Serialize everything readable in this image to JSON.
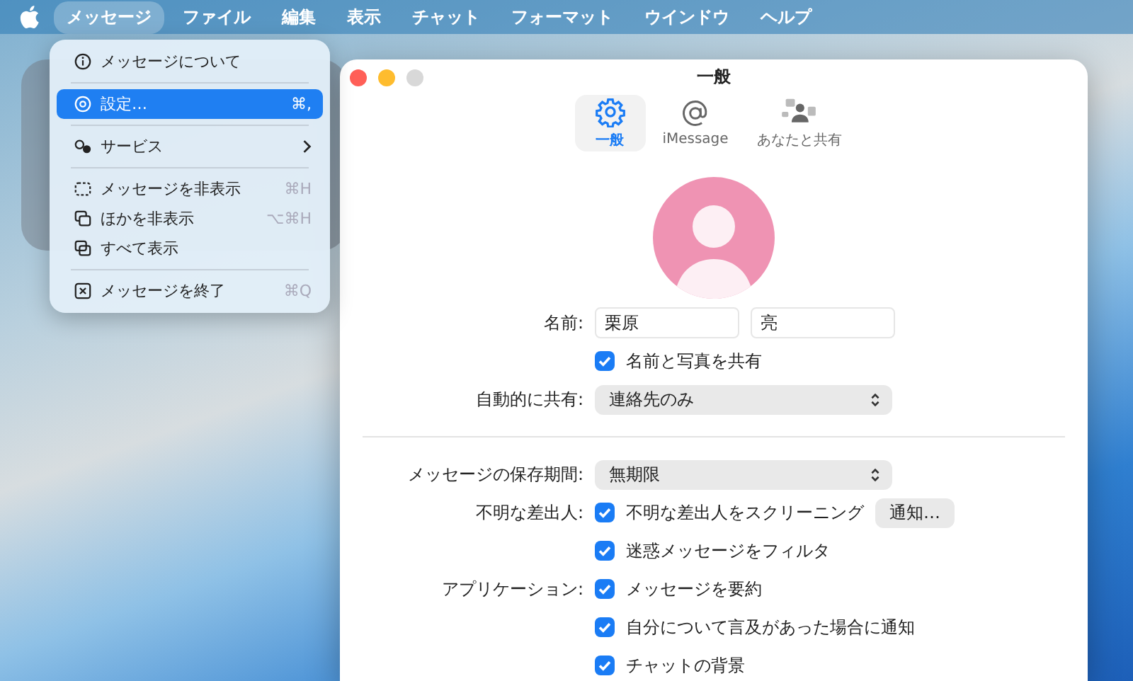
{
  "menubar": {
    "items": [
      {
        "label": "メッセージ",
        "selected": true
      },
      {
        "label": "ファイル",
        "selected": false
      },
      {
        "label": "編集",
        "selected": false
      },
      {
        "label": "表示",
        "selected": false
      },
      {
        "label": "チャット",
        "selected": false
      },
      {
        "label": "フォーマット",
        "selected": false
      },
      {
        "label": "ウインドウ",
        "selected": false
      },
      {
        "label": "ヘルプ",
        "selected": false
      }
    ]
  },
  "menu": {
    "items": [
      {
        "kind": "item",
        "label": "メッセージについて",
        "selected": false
      },
      {
        "kind": "separator"
      },
      {
        "kind": "item",
        "label": "設定…",
        "shortcut": "⌘,",
        "selected": true
      },
      {
        "kind": "separator"
      },
      {
        "kind": "item",
        "label": "サービス",
        "selected": false,
        "submenu": true
      },
      {
        "kind": "separator"
      },
      {
        "kind": "item",
        "label": "メッセージを非表示",
        "shortcut": "⌘H",
        "selected": false
      },
      {
        "kind": "item",
        "label": "ほかを非表示",
        "shortcut": "⌥⌘H",
        "selected": false
      },
      {
        "kind": "item",
        "label": "すべて表示",
        "selected": false
      },
      {
        "kind": "separator"
      },
      {
        "kind": "item",
        "label": "メッセージを終了",
        "shortcut": "⌘Q",
        "selected": false
      }
    ]
  },
  "window": {
    "title": "一般",
    "tabs": [
      {
        "label": "一般",
        "selected": true
      },
      {
        "label": "iMessage",
        "selected": false
      },
      {
        "label": "あなたと共有",
        "selected": false
      }
    ],
    "rows": [
      {
        "kind": "name",
        "label": "名前:",
        "fields": [
          "栗原",
          "亮"
        ]
      },
      {
        "kind": "checkbox",
        "text": "名前と写真を共有",
        "checked": true
      },
      {
        "kind": "select",
        "label": "自動的に共有:",
        "value": "連絡先のみ"
      },
      {
        "kind": "divider"
      },
      {
        "kind": "select",
        "label": "メッセージの保存期間:",
        "value": "無期限"
      },
      {
        "kind": "checkbox",
        "label": "不明な差出人:",
        "text": "不明な差出人をスクリーニング",
        "checked": true,
        "button": "通知…"
      },
      {
        "kind": "checkbox",
        "text": "迷惑メッセージをフィルタ",
        "checked": true
      },
      {
        "kind": "checkbox",
        "label": "アプリケーション:",
        "text": "メッセージを要約",
        "checked": true
      },
      {
        "kind": "checkbox",
        "text": "自分について言及があった場合に通知",
        "checked": true
      },
      {
        "kind": "checkbox",
        "text": "チャットの背景",
        "checked": true
      }
    ]
  }
}
